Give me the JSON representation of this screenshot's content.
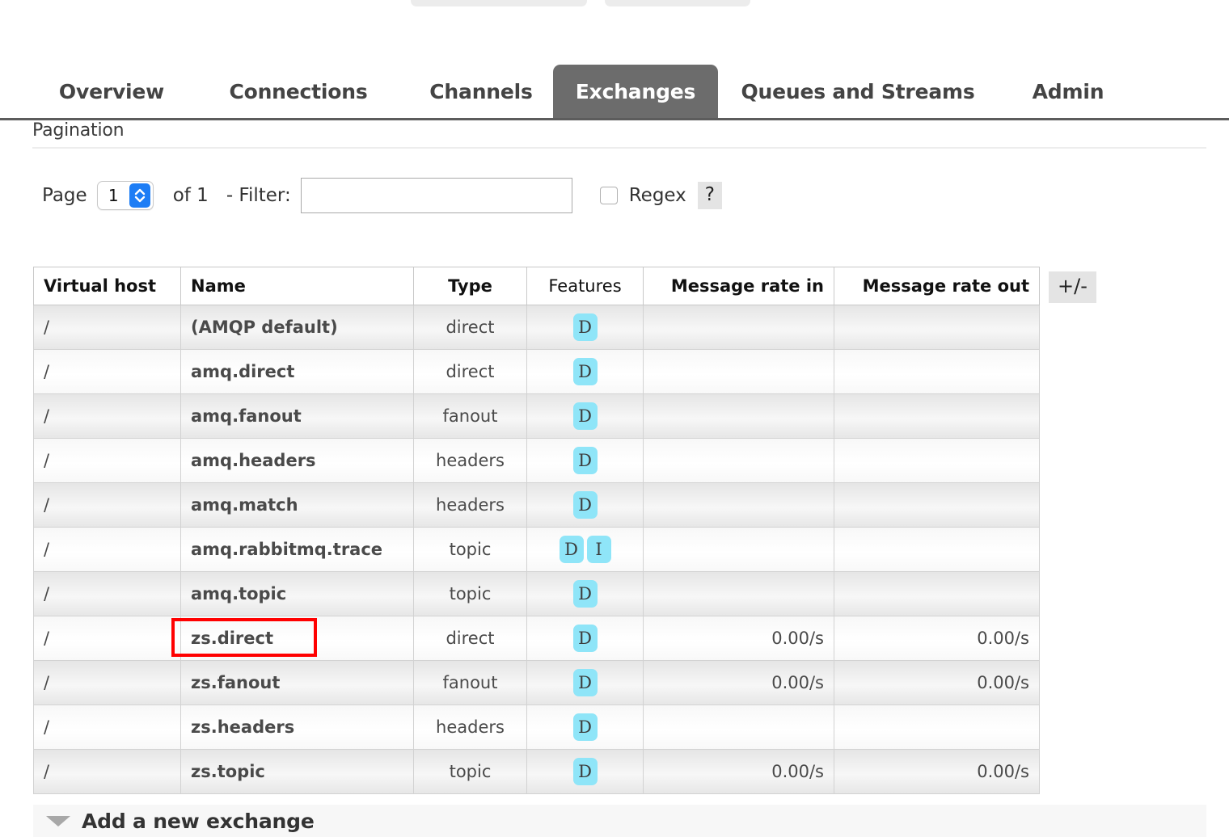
{
  "top_partial_buttons": [
    {
      "label": ""
    },
    {
      "label": ""
    }
  ],
  "tabs": [
    {
      "label": "Overview",
      "active": false
    },
    {
      "label": "Connections",
      "active": false
    },
    {
      "label": "Channels",
      "active": false
    },
    {
      "label": "Exchanges",
      "active": true
    },
    {
      "label": "Queues and Streams",
      "active": false
    },
    {
      "label": "Admin",
      "active": false
    }
  ],
  "pagination": {
    "heading": "Pagination",
    "page_label": "Page",
    "page_value": "1",
    "stepper_up_icon": "chevron-up-icon",
    "stepper_down_icon": "chevron-down-icon",
    "of_count": "of 1",
    "filter_label": "- Filter:",
    "filter_value": "",
    "filter_placeholder": "",
    "regex_label": "Regex",
    "regex_checked": false,
    "help_label": "?"
  },
  "table": {
    "columns": [
      {
        "label": "Virtual host",
        "bold": true
      },
      {
        "label": "Name",
        "bold": true
      },
      {
        "label": "Type",
        "bold": true
      },
      {
        "label": "Features",
        "bold": false
      },
      {
        "label": "Message rate in",
        "bold": true
      },
      {
        "label": "Message rate out",
        "bold": true
      }
    ],
    "toggle_columns_label": "+/-",
    "rows": [
      {
        "vhost": "/",
        "name": "(AMQP default)",
        "type": "direct",
        "features": [
          "D"
        ],
        "rate_in": "",
        "rate_out": "",
        "highlighted": false
      },
      {
        "vhost": "/",
        "name": "amq.direct",
        "type": "direct",
        "features": [
          "D"
        ],
        "rate_in": "",
        "rate_out": "",
        "highlighted": false
      },
      {
        "vhost": "/",
        "name": "amq.fanout",
        "type": "fanout",
        "features": [
          "D"
        ],
        "rate_in": "",
        "rate_out": "",
        "highlighted": false
      },
      {
        "vhost": "/",
        "name": "amq.headers",
        "type": "headers",
        "features": [
          "D"
        ],
        "rate_in": "",
        "rate_out": "",
        "highlighted": false
      },
      {
        "vhost": "/",
        "name": "amq.match",
        "type": "headers",
        "features": [
          "D"
        ],
        "rate_in": "",
        "rate_out": "",
        "highlighted": false
      },
      {
        "vhost": "/",
        "name": "amq.rabbitmq.trace",
        "type": "topic",
        "features": [
          "D",
          "I"
        ],
        "rate_in": "",
        "rate_out": "",
        "highlighted": false
      },
      {
        "vhost": "/",
        "name": "amq.topic",
        "type": "topic",
        "features": [
          "D"
        ],
        "rate_in": "",
        "rate_out": "",
        "highlighted": false
      },
      {
        "vhost": "/",
        "name": "zs.direct",
        "type": "direct",
        "features": [
          "D"
        ],
        "rate_in": "0.00/s",
        "rate_out": "0.00/s",
        "highlighted": true
      },
      {
        "vhost": "/",
        "name": "zs.fanout",
        "type": "fanout",
        "features": [
          "D"
        ],
        "rate_in": "0.00/s",
        "rate_out": "0.00/s",
        "highlighted": false
      },
      {
        "vhost": "/",
        "name": "zs.headers",
        "type": "headers",
        "features": [
          "D"
        ],
        "rate_in": "",
        "rate_out": "",
        "highlighted": false
      },
      {
        "vhost": "/",
        "name": "zs.topic",
        "type": "topic",
        "features": [
          "D"
        ],
        "rate_in": "0.00/s",
        "rate_out": "0.00/s",
        "highlighted": false
      }
    ]
  },
  "add_exchange": {
    "label": "Add a new exchange",
    "caret_icon": "caret-down-icon",
    "expanded": false
  },
  "colors": {
    "active_tab_bg": "#6c6c6c",
    "feature_badge_bg": "#8fe5f8",
    "highlight_box": "#ff0000",
    "stepper_blue": "#1d7df5",
    "button_gray": "#e4e4e4"
  }
}
